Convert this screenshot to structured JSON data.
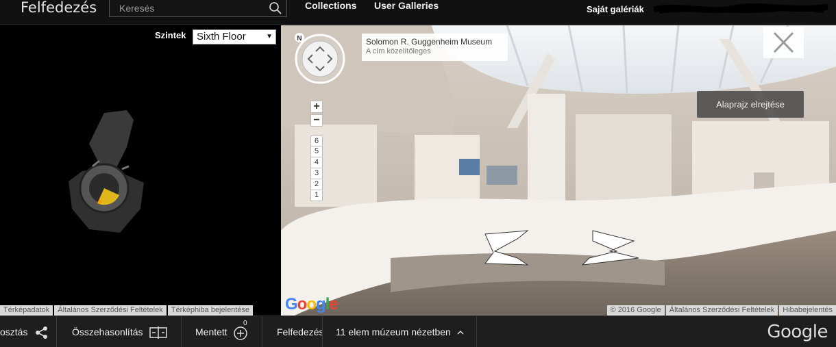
{
  "header": {
    "brand": "Felfedezés",
    "search_placeholder": "Keresés",
    "nav": [
      "Collections",
      "User Galleries"
    ],
    "my_galleries": "Saját galériák"
  },
  "floorplan": {
    "levels_label": "Szintek",
    "selected_floor": "Sixth Floor",
    "footer": [
      "Térképadatok",
      "Általános Szerződési Feltételek",
      "Térképhiba bejelentése"
    ]
  },
  "streetview": {
    "place_title": "Solomon R. Guggenheim Museum",
    "place_subtitle": "A cím közelítőleges",
    "hide_plan_button": "Alaprajz elrejtése",
    "zoom_in": "+",
    "zoom_out": "−",
    "levels": [
      "6",
      "5",
      "4",
      "3",
      "2",
      "1"
    ],
    "compass_letter": "N",
    "logo": "Google",
    "footer": [
      "© 2016 Google",
      "Általános Szerződési Feltételek",
      "Hibabejelentés"
    ]
  },
  "bottombar": {
    "share": "osztás",
    "compare": "Összehasonlítás",
    "saved": "Mentett",
    "saved_count": "0",
    "explore": "Felfedezés",
    "items_in_museum": "11 elem múzeum nézetben",
    "logo": "Google"
  },
  "colors": {
    "accent_yellow": "#f5c518",
    "google_blue": "#4285f4",
    "google_red": "#ea4335",
    "google_yellow": "#fbbc05",
    "google_green": "#34a853"
  }
}
